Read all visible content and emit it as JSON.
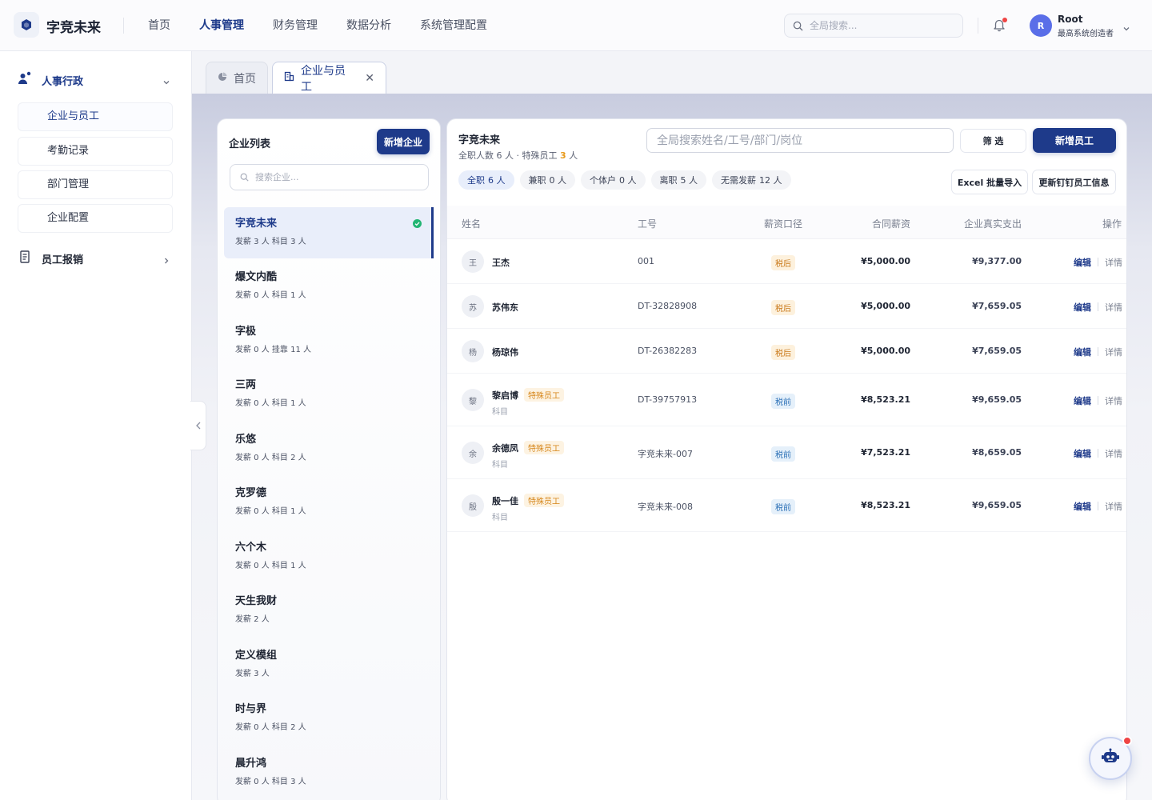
{
  "app": {
    "name": "字竞未来"
  },
  "nav": [
    "首页",
    "人事管理",
    "财务管理",
    "数据分析",
    "系统管理配置"
  ],
  "search": {
    "placeholder": "全局搜索..."
  },
  "user": {
    "initial": "R",
    "name": "Root",
    "role": "最高系统创造者"
  },
  "sidebar": {
    "group1": "人事行政",
    "items": [
      "企业与员工",
      "考勤记录",
      "部门管理",
      "企业配置"
    ],
    "group2": "员工报销"
  },
  "tabs": {
    "home": "首页",
    "active": "企业与员工"
  },
  "company_panel": {
    "title": "企业列表",
    "add_button": "新增企业",
    "search_placeholder": "搜索企业...",
    "companies": [
      {
        "name": "字竞未来",
        "meta": "发薪 3 人  科目 3 人"
      },
      {
        "name": "爆文内酷",
        "meta": "发薪 0 人  科目 1 人"
      },
      {
        "name": "字极",
        "meta": "发薪 0 人  挂靠 11 人"
      },
      {
        "name": "三两",
        "meta": "发薪 0 人  科目 1 人"
      },
      {
        "name": "乐悠",
        "meta": "发薪 0 人  科目 2 人"
      },
      {
        "name": "克罗德",
        "meta": "发薪 0 人  科目 1 人"
      },
      {
        "name": "六个木",
        "meta": "发薪 0 人  科目 1 人"
      },
      {
        "name": "天生我财",
        "meta": "发薪 2 人"
      },
      {
        "name": "定义模组",
        "meta": "发薪 3 人"
      },
      {
        "name": "时与界",
        "meta": "发薪 0 人  科目 2 人"
      },
      {
        "name": "晨升鸿",
        "meta": "发薪 0 人  科目 3 人"
      }
    ]
  },
  "employee_panel": {
    "company": "字竞未来",
    "summary_prefix": "全职人数 6 人 · 特殊员工 ",
    "special_count": "3",
    "summary_suffix": " 人",
    "search_placeholder": "全局搜索姓名/工号/部门/岗位",
    "filter_button": "筛 选",
    "add_button": "新增员工",
    "excel_button": "Excel 批量导入",
    "dingtalk_button": "更新钉钉员工信息",
    "chips": [
      {
        "label": "全职",
        "count": "6 人"
      },
      {
        "label": "兼职",
        "count": "0 人"
      },
      {
        "label": "个体户",
        "count": "0 人"
      },
      {
        "label": "离职",
        "count": "5 人"
      },
      {
        "label": "无需发薪",
        "count": "12 人"
      }
    ],
    "columns": {
      "name": "姓名",
      "id": "工号",
      "tax": "薪资口径",
      "salary": "合同薪资",
      "expense": "企业真实支出",
      "action": "操作"
    },
    "rows": [
      {
        "initial": "王",
        "name": "王杰",
        "tag": "",
        "sub": "",
        "id": "001",
        "tax": "税后",
        "salary": "¥5,000.00",
        "expense": "¥9,377.00"
      },
      {
        "initial": "苏",
        "name": "苏伟东",
        "tag": "",
        "sub": "",
        "id": "DT-32828908",
        "tax": "税后",
        "salary": "¥5,000.00",
        "expense": "¥7,659.05"
      },
      {
        "initial": "杨",
        "name": "杨琼伟",
        "tag": "",
        "sub": "",
        "id": "DT-26382283",
        "tax": "税后",
        "salary": "¥5,000.00",
        "expense": "¥7,659.05"
      },
      {
        "initial": "黎",
        "name": "黎启博",
        "tag": "特殊员工",
        "sub": "科目",
        "id": "DT-39757913",
        "tax": "税前",
        "salary": "¥8,523.21",
        "expense": "¥9,659.05"
      },
      {
        "initial": "余",
        "name": "余德凤",
        "tag": "特殊员工",
        "sub": "科目",
        "id": "字竞未来-007",
        "tax": "税前",
        "salary": "¥7,523.21",
        "expense": "¥8,659.05"
      },
      {
        "initial": "殷",
        "name": "殷一佳",
        "tag": "特殊员工",
        "sub": "科目",
        "id": "字竞未来-008",
        "tax": "税前",
        "salary": "¥8,523.21",
        "expense": "¥9,659.05"
      }
    ],
    "edit_label": "编辑",
    "detail_label": "详情"
  },
  "colors": {
    "primary": "#1e3a8a",
    "accent_orange": "#e89a1b",
    "success": "#22b573",
    "danger": "#ef4444"
  }
}
